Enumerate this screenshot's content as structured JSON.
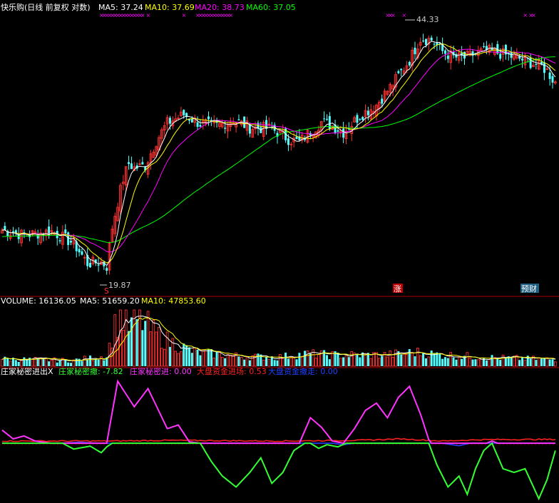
{
  "colors": {
    "up": "#ff3232",
    "down": "#54ffff",
    "ma5": "#ffffff",
    "ma10": "#ffff00",
    "ma20": "#ff00ff",
    "ma60": "#00ff00",
    "divider": "#b00000",
    "x_marker": "#ff00ff",
    "sig_pink": "#ff33ff",
    "sig_green": "#33ff33",
    "sig_red": "#ff2020",
    "sig_blue": "#2040ff"
  },
  "price_panel": {
    "title": "快乐购(日线 前复权 对数)",
    "legend": [
      {
        "label": "MA5: 37.24",
        "color": "#ffffff"
      },
      {
        "label": "MA10: 37.69",
        "color": "#ffff00"
      },
      {
        "label": "MA20: 38.73",
        "color": "#ff00ff"
      },
      {
        "label": "MA60: 37.05",
        "color": "#00ff00"
      }
    ],
    "high_label": "44.33",
    "low_label": "19.87",
    "low_marker": "S",
    "tag_zhang": "涨",
    "tag_report": "预财"
  },
  "volume_panel": {
    "legend": [
      {
        "label": "VOLUME: 16136.05",
        "color": "#ffffff"
      },
      {
        "label": "MA5: 51659.20",
        "color": "#ffffff"
      },
      {
        "label": "MA10: 47853.60",
        "color": "#ffff00"
      }
    ]
  },
  "indicator_panel": {
    "legend": [
      {
        "label": "庄家秘密进出X",
        "color": "#ffffff"
      },
      {
        "label": "庄家秘密撤: -7.82",
        "color": "#33ff33"
      },
      {
        "label": "庄家秘密进: 0.00",
        "color": "#ff33ff"
      },
      {
        "label": "大盘资金进场: 0.53",
        "color": "#ff2020"
      },
      {
        "label": "大盘资金撤走: 0.00",
        "color": "#2040ff"
      }
    ]
  },
  "chart_data": {
    "type": "candlestick",
    "scale": "log",
    "anchors": [
      [
        0,
        22.8
      ],
      [
        8,
        22.4
      ],
      [
        18,
        22.7
      ],
      [
        26,
        21.8
      ],
      [
        31,
        20.4
      ],
      [
        36,
        20.5
      ],
      [
        38,
        20.2
      ],
      [
        40,
        23.0
      ],
      [
        44,
        27.0
      ],
      [
        46,
        28.4
      ],
      [
        48,
        28.0
      ],
      [
        52,
        28.2
      ],
      [
        56,
        30.6
      ],
      [
        60,
        32.5
      ],
      [
        66,
        33.4
      ],
      [
        72,
        32.4
      ],
      [
        78,
        32.2
      ],
      [
        84,
        32.8
      ],
      [
        90,
        32.0
      ],
      [
        98,
        31.9
      ],
      [
        104,
        30.8
      ],
      [
        108,
        30.5
      ],
      [
        112,
        31.6
      ],
      [
        116,
        32.6
      ],
      [
        120,
        32.2
      ],
      [
        124,
        31.5
      ],
      [
        130,
        33.3
      ],
      [
        136,
        34.5
      ],
      [
        142,
        37.0
      ],
      [
        148,
        40.0
      ],
      [
        152,
        43.0
      ],
      [
        156,
        42.8
      ],
      [
        160,
        41.2
      ],
      [
        164,
        40.4
      ],
      [
        168,
        40.3
      ],
      [
        172,
        40.9
      ],
      [
        176,
        41.3
      ],
      [
        180,
        41.0
      ],
      [
        184,
        40.6
      ],
      [
        188,
        40.2
      ],
      [
        192,
        39.7
      ],
      [
        196,
        39.2
      ],
      [
        198,
        38.6
      ],
      [
        200,
        37.6
      ],
      [
        201,
        37.24
      ]
    ],
    "volume_anchors": [
      [
        0,
        0.13
      ],
      [
        10,
        0.12
      ],
      [
        25,
        0.1
      ],
      [
        38,
        0.18
      ],
      [
        41,
        0.7
      ],
      [
        43,
        0.9
      ],
      [
        46,
        0.7
      ],
      [
        50,
        0.85
      ],
      [
        55,
        0.6
      ],
      [
        60,
        0.45
      ],
      [
        70,
        0.25
      ],
      [
        85,
        0.18
      ],
      [
        100,
        0.16
      ],
      [
        110,
        0.22
      ],
      [
        120,
        0.2
      ],
      [
        140,
        0.2
      ],
      [
        150,
        0.25
      ],
      [
        160,
        0.2
      ],
      [
        180,
        0.15
      ],
      [
        201,
        0.12
      ]
    ],
    "indicator": {
      "ylim": [
        -8,
        9
      ],
      "pink": [
        [
          0,
          1.8
        ],
        [
          4,
          0.6
        ],
        [
          8,
          1.0
        ],
        [
          12,
          0.3
        ],
        [
          18,
          0.0
        ],
        [
          38,
          0.0
        ],
        [
          42,
          8.5
        ],
        [
          48,
          5.0
        ],
        [
          53,
          7.5
        ],
        [
          60,
          2.0
        ],
        [
          64,
          2.5
        ],
        [
          68,
          0.2
        ],
        [
          72,
          0.0
        ],
        [
          108,
          0.0
        ],
        [
          112,
          3.5
        ],
        [
          116,
          2.2
        ],
        [
          120,
          0.3
        ],
        [
          124,
          0.0
        ],
        [
          128,
          2.0
        ],
        [
          132,
          4.5
        ],
        [
          136,
          5.5
        ],
        [
          140,
          3.5
        ],
        [
          144,
          6.3
        ],
        [
          148,
          7.8
        ],
        [
          152,
          4.0
        ],
        [
          155,
          0.5
        ],
        [
          156,
          0.0
        ],
        [
          176,
          0.0
        ],
        [
          178,
          0.3
        ],
        [
          180,
          0.0
        ],
        [
          201,
          0.0
        ]
      ],
      "green": [
        [
          0,
          0.0
        ],
        [
          22,
          0.0
        ],
        [
          26,
          -0.8
        ],
        [
          32,
          -0.4
        ],
        [
          36,
          -1.3
        ],
        [
          38,
          -0.5
        ],
        [
          40,
          0.0
        ],
        [
          72,
          0.0
        ],
        [
          76,
          -2.5
        ],
        [
          80,
          -4.5
        ],
        [
          85,
          -6.0
        ],
        [
          90,
          -4.0
        ],
        [
          94,
          -2.0
        ],
        [
          98,
          -5.5
        ],
        [
          102,
          -4.0
        ],
        [
          106,
          -1.0
        ],
        [
          110,
          0.0
        ],
        [
          112,
          0.0
        ],
        [
          115,
          -0.7
        ],
        [
          118,
          -0.2
        ],
        [
          122,
          -0.5
        ],
        [
          125,
          0.0
        ],
        [
          155,
          0.0
        ],
        [
          158,
          -3.0
        ],
        [
          162,
          -6.0
        ],
        [
          166,
          -4.5
        ],
        [
          169,
          -7.0
        ],
        [
          172,
          -3.5
        ],
        [
          175,
          -1.0
        ],
        [
          178,
          0.0
        ],
        [
          182,
          -3.5
        ],
        [
          186,
          -4.0
        ],
        [
          190,
          -3.5
        ],
        [
          195,
          -7.6
        ],
        [
          198,
          -5.0
        ],
        [
          201,
          -1.0
        ]
      ],
      "red": [
        [
          0,
          0.3
        ],
        [
          40,
          0.3
        ],
        [
          60,
          0.4
        ],
        [
          100,
          0.3
        ],
        [
          130,
          0.4
        ],
        [
          145,
          0.6
        ],
        [
          160,
          0.3
        ],
        [
          175,
          0.5
        ],
        [
          201,
          0.53
        ]
      ],
      "blue": [
        [
          0,
          0.0
        ],
        [
          20,
          0.0
        ],
        [
          28,
          0.15
        ],
        [
          36,
          0.0
        ],
        [
          120,
          0.0
        ],
        [
          124,
          -0.2
        ],
        [
          128,
          0.0
        ],
        [
          160,
          0.0
        ],
        [
          166,
          -0.35
        ],
        [
          170,
          0.0
        ],
        [
          201,
          0.0
        ]
      ]
    }
  }
}
